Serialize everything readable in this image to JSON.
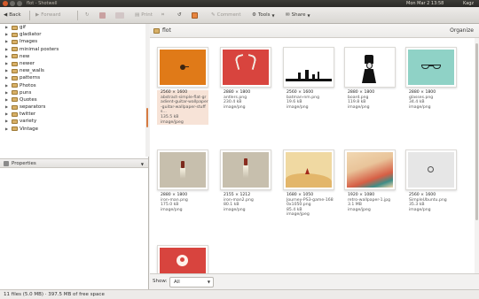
{
  "panel": {
    "window_title": "flot - Shotwell",
    "indicators": [
      "Mon Mar 2 13:58",
      "Kagz"
    ]
  },
  "toolbar": {
    "back": "Back",
    "forward": "Forward",
    "print": "Print",
    "comment": "Comment",
    "tools": "Tools",
    "share": "Share"
  },
  "tree": {
    "items": [
      "gif",
      "gladiator",
      "Images",
      "minimal posters",
      "new",
      "newer",
      "new_walls",
      "patterns",
      "Photos",
      "puns",
      "Quotes",
      "separators",
      "twitter",
      "variety",
      "Vintage"
    ]
  },
  "properties": {
    "label": "Properties"
  },
  "path": {
    "folder": "flot",
    "organize": "Organize"
  },
  "files": [
    {
      "dims": "2560 × 1600",
      "name": "abstract-simple-flat-gradient-guitar-wallpaper-guitar-wallpaper-stuffs...",
      "size": "135.5 kB",
      "type": "image/jpeg",
      "art": "orange"
    },
    {
      "dims": "2880 × 1800",
      "name": "antlers.png",
      "size": "230.4 kB",
      "type": "image/png",
      "art": "red"
    },
    {
      "dims": "2560 × 1600",
      "name": "batman-nm.png",
      "size": "19.6 kB",
      "type": "image/png",
      "art": "white"
    },
    {
      "dims": "2880 × 1800",
      "name": "board.png",
      "size": "119.8 kB",
      "type": "image/png",
      "art": "portrait"
    },
    {
      "dims": "2880 × 1800",
      "name": "glasses.png",
      "size": "34.4 kB",
      "type": "image/png",
      "art": "teal"
    },
    {
      "dims": "2880 × 1800",
      "name": "iron-man.png",
      "size": "175.0 kB",
      "type": "image/png",
      "art": "beige"
    },
    {
      "dims": "2155 × 1212",
      "name": "iron-man2.png",
      "size": "80.1 kB",
      "type": "image/png",
      "art": "beige2"
    },
    {
      "dims": "1680 × 1050",
      "name": "Journey-PS3-game-1680x1050.png",
      "size": "85.4 kB",
      "type": "image/jpeg",
      "art": "sand"
    },
    {
      "dims": "1920 × 1080",
      "name": "retro-wallpaper-1.jpg",
      "size": "3.1 MB",
      "type": "image/jpeg",
      "art": "retro"
    },
    {
      "dims": "2560 × 1600",
      "name": "SimpleUbuntu.png",
      "size": "35.3 kB",
      "type": "image/png",
      "art": "grey"
    },
    {
      "dims": "",
      "name": "",
      "size": "",
      "type": "",
      "art": "red-bottom"
    }
  ],
  "filter": {
    "label": "Show:",
    "value": "All"
  },
  "status": {
    "text": "11 files (5.0 MB) · 397.5 MB of free space"
  },
  "colors": {
    "accent": "#d67b42",
    "selected_caption": "#f7e3d7"
  }
}
